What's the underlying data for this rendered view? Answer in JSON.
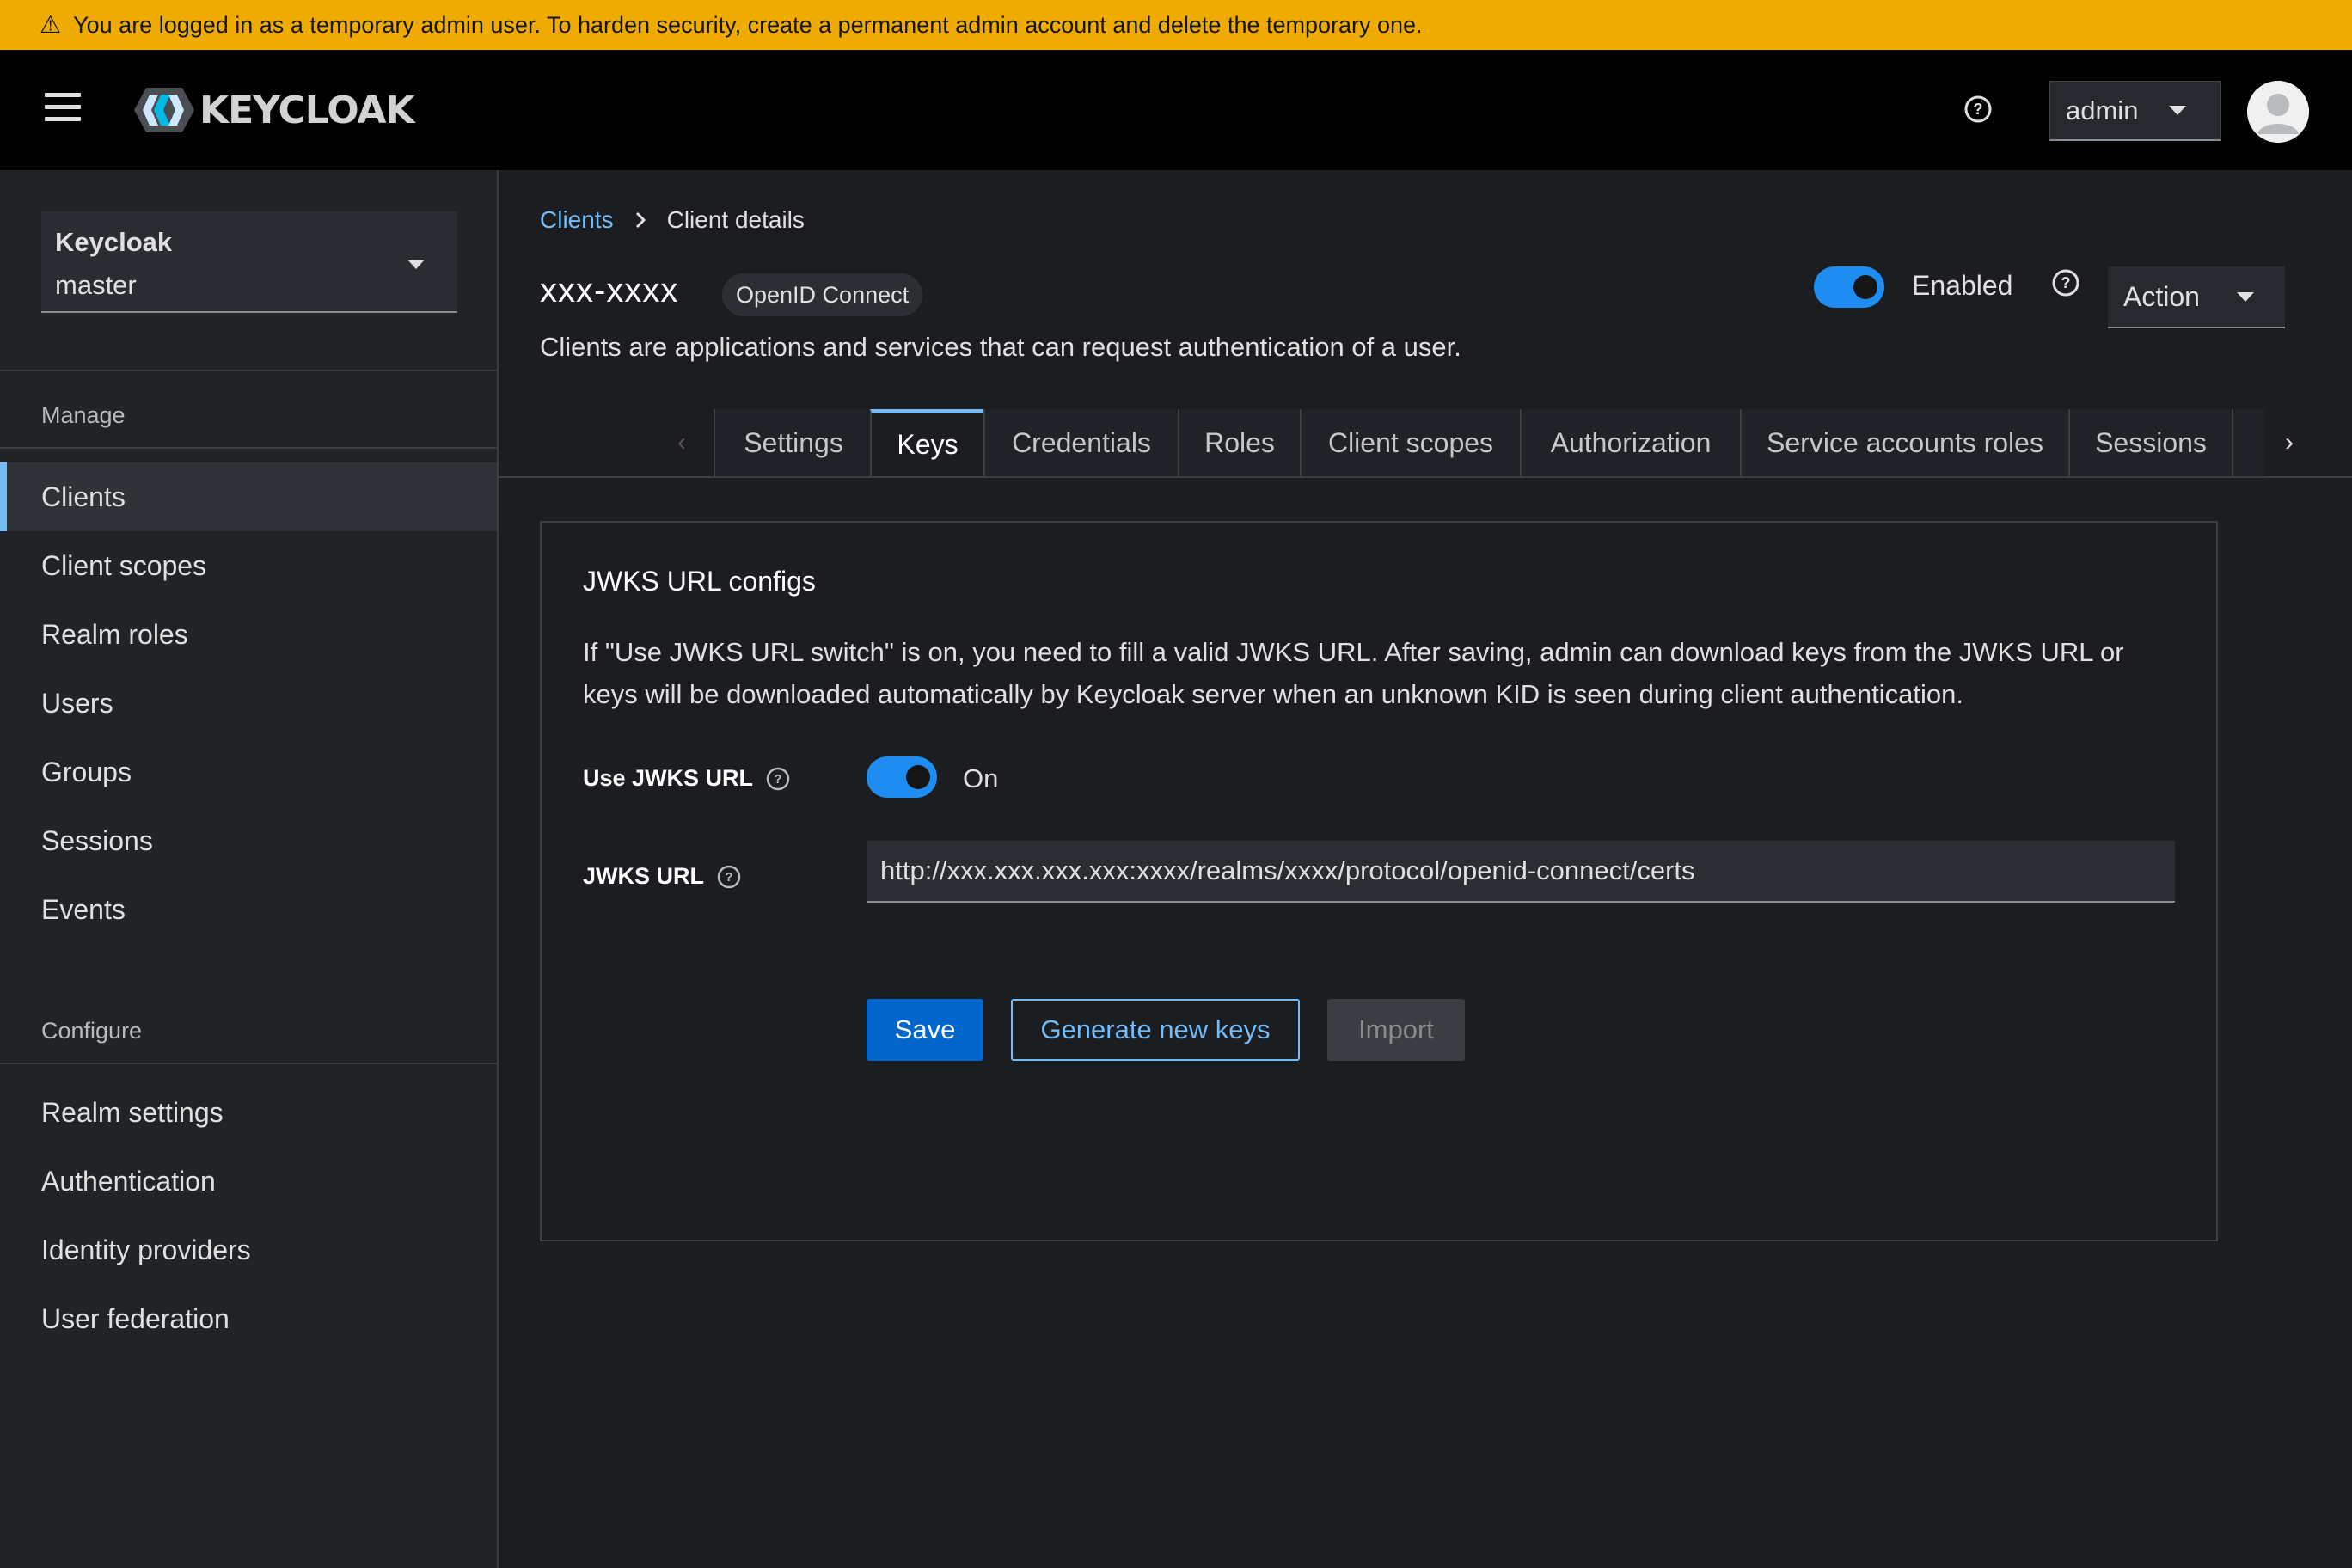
{
  "banner": {
    "icon": "warning-icon",
    "text": "You are logged in as a temporary admin user. To harden security, create a permanent admin account and delete the temporary one."
  },
  "masthead": {
    "logo_text": "KEYCLOAK",
    "user_label": "admin"
  },
  "sidebar": {
    "realm_name": "Keycloak",
    "realm_sub": "master",
    "manage_section": "Manage",
    "manage_items": [
      "Clients",
      "Client scopes",
      "Realm roles",
      "Users",
      "Groups",
      "Sessions",
      "Events"
    ],
    "configure_section": "Configure",
    "configure_items": [
      "Realm settings",
      "Authentication",
      "Identity providers",
      "User federation"
    ]
  },
  "breadcrumb": {
    "link": "Clients",
    "current": "Client details"
  },
  "header": {
    "client_id": "xxx-xxxx",
    "protocol_badge": "OpenID Connect",
    "description": "Clients are applications and services that can request authentication of a user.",
    "enabled_label": "Enabled",
    "enabled": true,
    "action_label": "Action"
  },
  "tabs": [
    "Settings",
    "Keys",
    "Credentials",
    "Roles",
    "Client scopes",
    "Authorization",
    "Service accounts roles",
    "Sessions"
  ],
  "active_tab": "Keys",
  "jwks": {
    "title": "JWKS URL configs",
    "help": "If \"Use JWKS URL switch\" is on, you need to fill a valid JWKS URL. After saving, admin can download keys from the JWKS URL or keys will be downloaded automatically by Keycloak server when an unknown KID is seen during client authentication.",
    "use_label": "Use JWKS URL",
    "use_value": "On",
    "url_label": "JWKS URL",
    "url_value": "http://xxx.xxx.xxx.xxx:xxxx/realms/xxxx/protocol/openid-connect/certs",
    "save": "Save",
    "generate": "Generate new keys",
    "import": "Import"
  },
  "colors": {
    "banner": "#f0ab00",
    "accent": "#73bcf7",
    "primary": "#0066cc",
    "switch_on": "#1e8cf0"
  }
}
